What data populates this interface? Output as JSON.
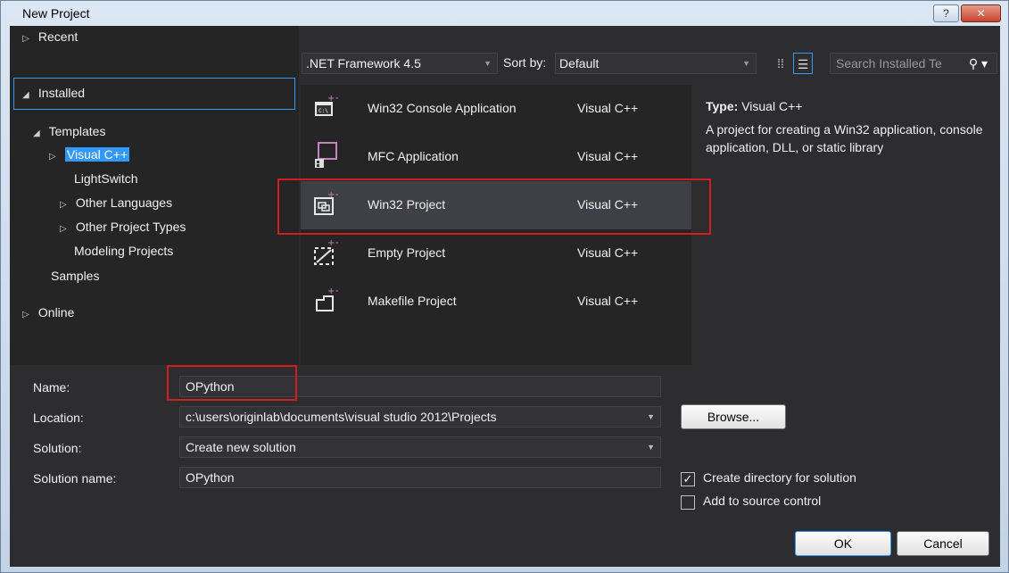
{
  "window": {
    "title": "New Project",
    "help": "?",
    "close": "✕"
  },
  "nav": {
    "recent": "Recent",
    "installed": "Installed",
    "templates": "Templates",
    "visual_cpp": "Visual C++",
    "lightswitch": "LightSwitch",
    "other_languages": "Other Languages",
    "other_project_types": "Other Project Types",
    "modeling_projects": "Modeling Projects",
    "samples": "Samples",
    "online": "Online"
  },
  "toolbar": {
    "framework": ".NET Framework 4.5",
    "sort_label": "Sort by:",
    "sort_value": "Default",
    "search_placeholder": "Search Installed Te"
  },
  "templates": [
    {
      "name": "Win32 Console Application",
      "lang": "Visual C++",
      "icon": "console-app-icon"
    },
    {
      "name": "MFC Application",
      "lang": "Visual C++",
      "icon": "mfc-app-icon"
    },
    {
      "name": "Win32 Project",
      "lang": "Visual C++",
      "icon": "win32-project-icon"
    },
    {
      "name": "Empty Project",
      "lang": "Visual C++",
      "icon": "empty-project-icon"
    },
    {
      "name": "Makefile Project",
      "lang": "Visual C++",
      "icon": "makefile-project-icon"
    }
  ],
  "description": {
    "type_label": "Type:",
    "type_value": "Visual C++",
    "text": "A project for creating a Win32 application, console application, DLL, or static library"
  },
  "form": {
    "name_label": "Name:",
    "name_value": "OPython",
    "location_label": "Location:",
    "location_value": "c:\\users\\originlab\\documents\\visual studio 2012\\Projects",
    "solution_label": "Solution:",
    "solution_value": "Create new solution",
    "solution_name_label": "Solution name:",
    "solution_name_value": "OPython",
    "browse": "Browse...",
    "create_dir": "Create directory for solution",
    "add_source_control": "Add to source control",
    "ok": "OK",
    "cancel": "Cancel"
  }
}
